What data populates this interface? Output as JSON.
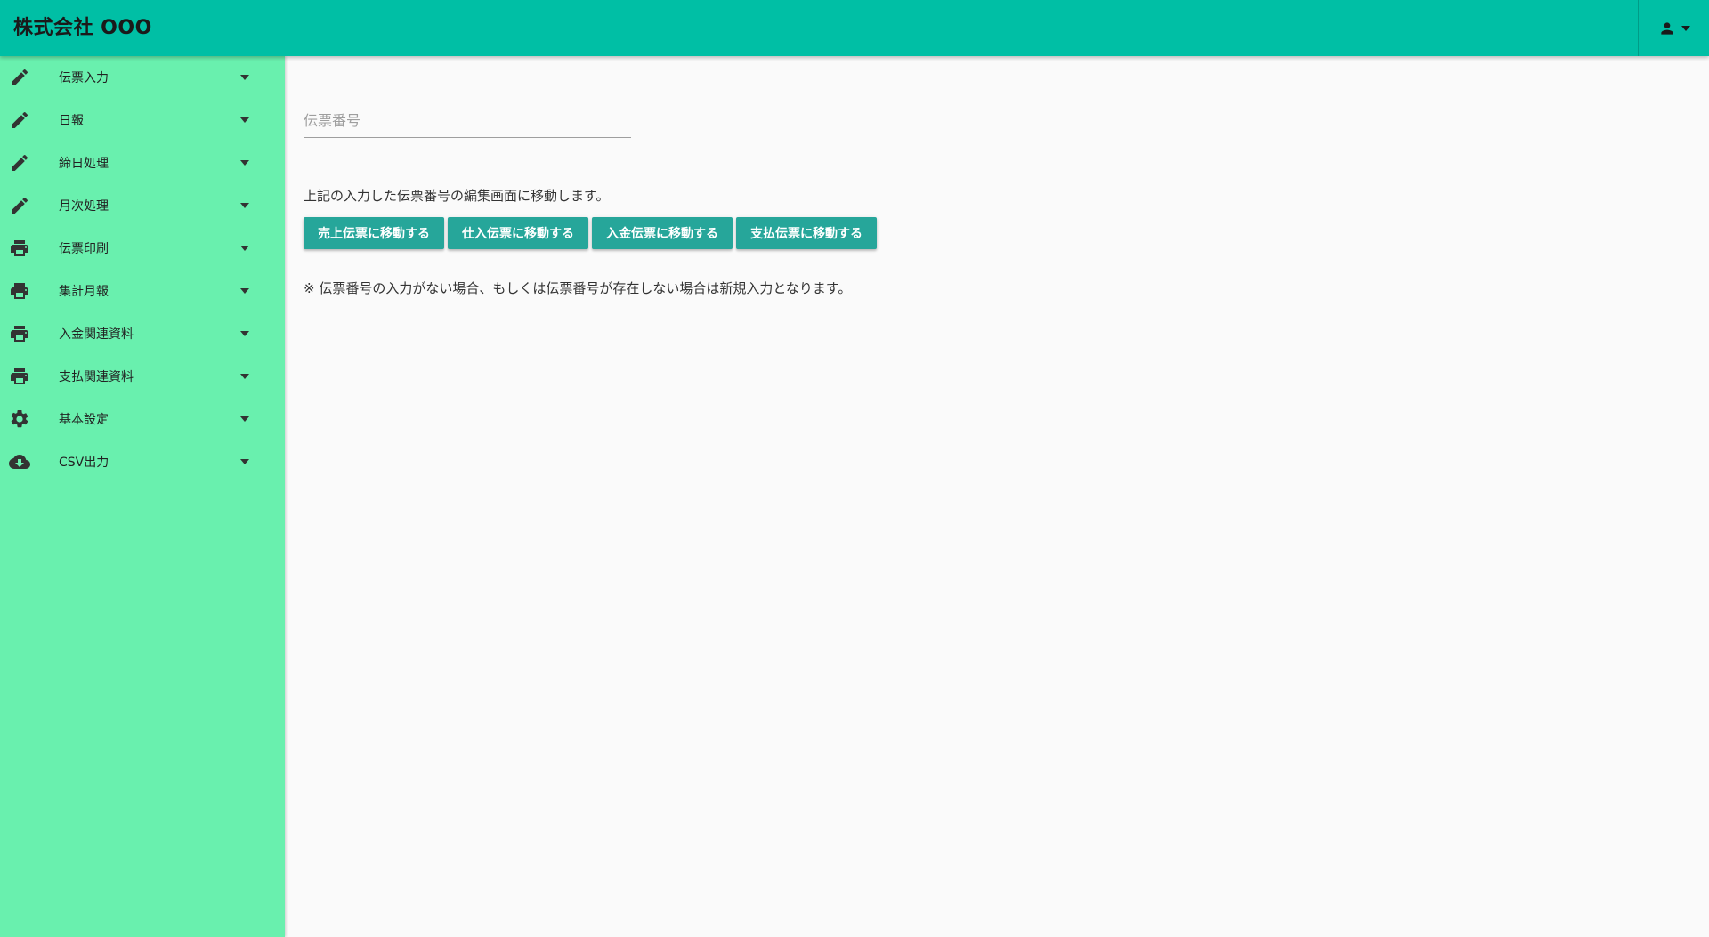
{
  "header": {
    "company_name": "株式会社 OOO"
  },
  "sidebar": {
    "items": [
      {
        "label": "伝票入力",
        "icon": "pencil-icon"
      },
      {
        "label": "日報",
        "icon": "pencil-icon"
      },
      {
        "label": "締日処理",
        "icon": "pencil-icon"
      },
      {
        "label": "月次処理",
        "icon": "pencil-icon"
      },
      {
        "label": "伝票印刷",
        "icon": "printer-icon"
      },
      {
        "label": "集計月報",
        "icon": "printer-icon"
      },
      {
        "label": "入金関連資料",
        "icon": "printer-icon"
      },
      {
        "label": "支払関連資料",
        "icon": "printer-icon"
      },
      {
        "label": "基本設定",
        "icon": "gear-icon"
      },
      {
        "label": "CSV出力",
        "icon": "cloud-download-icon"
      }
    ]
  },
  "main": {
    "slip_number": {
      "placeholder": "伝票番号",
      "value": ""
    },
    "description": "上記の入力した伝票番号の編集画面に移動します。",
    "buttons": {
      "sales": "売上伝票に移動する",
      "purchase": "仕入伝票に移動する",
      "receipt": "入金伝票に移動する",
      "payment": "支払伝票に移動する"
    },
    "note": "※ 伝票番号の入力がない場合、もしくは伝票番号が存在しない場合は新規入力となります。"
  },
  "colors": {
    "header": "#00bfa5",
    "sidebar": "#69f0ae",
    "button": "#26a69a",
    "background": "#fafafa"
  }
}
